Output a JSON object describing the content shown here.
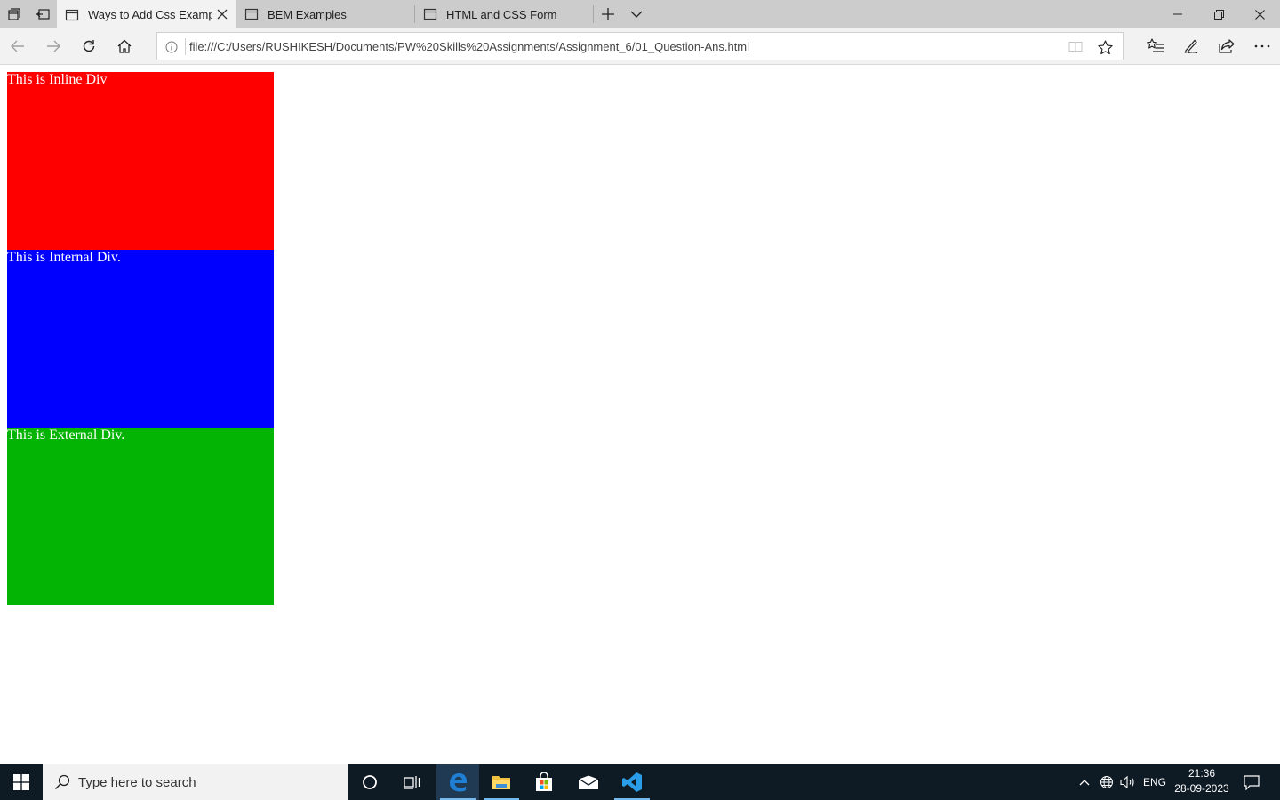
{
  "browser": {
    "tabs": [
      {
        "title": "Ways to Add Css Examp",
        "active": true
      },
      {
        "title": "BEM Examples",
        "active": false
      },
      {
        "title": "HTML and CSS Form",
        "active": false
      }
    ],
    "address_bar": {
      "url": "file:///C:/Users/RUSHIKESH/Documents/PW%20Skills%20Assignments/Assignment_6/01_Question-Ans.html"
    },
    "icons": {
      "tab_actions": "tab-actions-icon",
      "set_aside": "set-aside-tabs-icon",
      "new_tab": "plus-icon",
      "tab_preview": "chevron-down-icon",
      "minimize": "minimize-icon",
      "restore": "restore-icon",
      "close": "close-icon",
      "back": "back-arrow-icon",
      "forward": "forward-arrow-icon",
      "refresh": "refresh-icon",
      "home": "home-icon",
      "favorites": "favorites-list-icon",
      "notes": "pen-icon",
      "share": "share-icon",
      "more": "more-icon"
    }
  },
  "page": {
    "inline_div": {
      "text": "This is Inline Div",
      "color": "#ff0000"
    },
    "internal_div": {
      "text": "This is Internal Div.",
      "color": "#0000ff"
    },
    "external_div": {
      "text": "This is External Div.",
      "color": "#04b404"
    }
  },
  "taskbar": {
    "search_placeholder": "Type here to search",
    "apps": [
      "cortana-icon",
      "task-view-icon",
      "edge-icon",
      "file-explorer-icon",
      "store-icon",
      "mail-icon",
      "vscode-icon"
    ],
    "tray": {
      "language": "ENG",
      "time": "21:36",
      "date": "28-09-2023"
    }
  }
}
